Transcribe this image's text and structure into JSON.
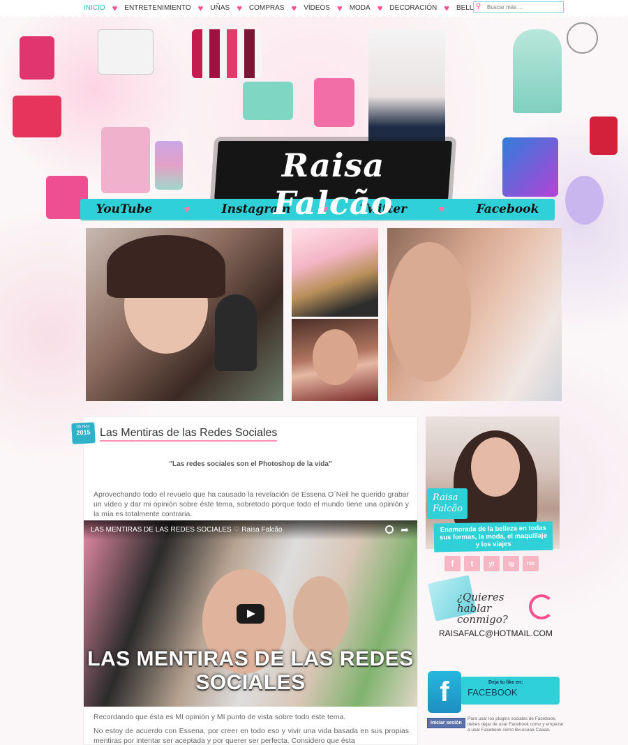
{
  "nav": {
    "items": [
      {
        "label": "INICIO",
        "active": true
      },
      {
        "label": "ENTRETENIMIENTO"
      },
      {
        "label": "UÑAS"
      },
      {
        "label": "COMPRAS"
      },
      {
        "label": "VÍDEOS"
      },
      {
        "label": "MODA"
      },
      {
        "label": "DECORACIÓN"
      },
      {
        "label": "BELLEZA"
      }
    ],
    "search_placeholder": "Buscar más ..."
  },
  "header": {
    "brand": "Raisa Falcão",
    "social_links": [
      "YouTube",
      "Instagram",
      "Twitter",
      "Facebook"
    ],
    "accent_color": "#2fd0d8",
    "heart_color": "#ff4f8f"
  },
  "post": {
    "date_day": "05 Nov",
    "date_year": "2015",
    "title": "Las Mentiras de las Redes Sociales",
    "quote": "\"Las redes sociales son el Photoshop de la vida\"",
    "para1": "Aprovechando todo el revuelo que ha causado la revelación de Essena O´Neil he querido grabar un vídeo y dar mi opinión sobre éste tema, sobretodo porque todo el mundo tiene una opinión y la mía es totalmente contraria.",
    "video": {
      "title": "LAS MENTIRAS DE LAS REDES SOCIALES ♡ Raisa Falcão",
      "caption_line1": "LAS MENTIRAS DE LAS REDES",
      "caption_line2": "SOCIALES"
    },
    "para2": "Recordando que ésta es MI opinión y MI punto de vista sobre todo este tema.",
    "para3": "No estoy de acuerdo con Essena, por creer en todo eso y vivir una vida basada en sus propias mentiras por intentar ser aceptada y por querer ser perfecta. Considero que ésta"
  },
  "sidebar": {
    "profile_name_line1": "Raisa",
    "profile_name_line2": "Falcão",
    "tagline": "Enamorada de la belleza en todas sus formas, la moda, el maquillaje y los viajes",
    "social_icons": [
      "f",
      "t",
      "yt",
      "ig",
      "rss"
    ],
    "contact_heading_line1": "¿Quieres hablar",
    "contact_heading_line2": "conmigo?",
    "email": "RAISAFALC@HOTMAIL.COM",
    "fb_small": "Deja tu like en:",
    "fb_big": "FACEBOOK",
    "fb_login": "Iniciar sesión",
    "fb_note": "Para usar los plugins sociales de Facebook, debes dejar de usar Facebook como y empezar a usar Facebook como Bи-еснаа Саааа."
  }
}
